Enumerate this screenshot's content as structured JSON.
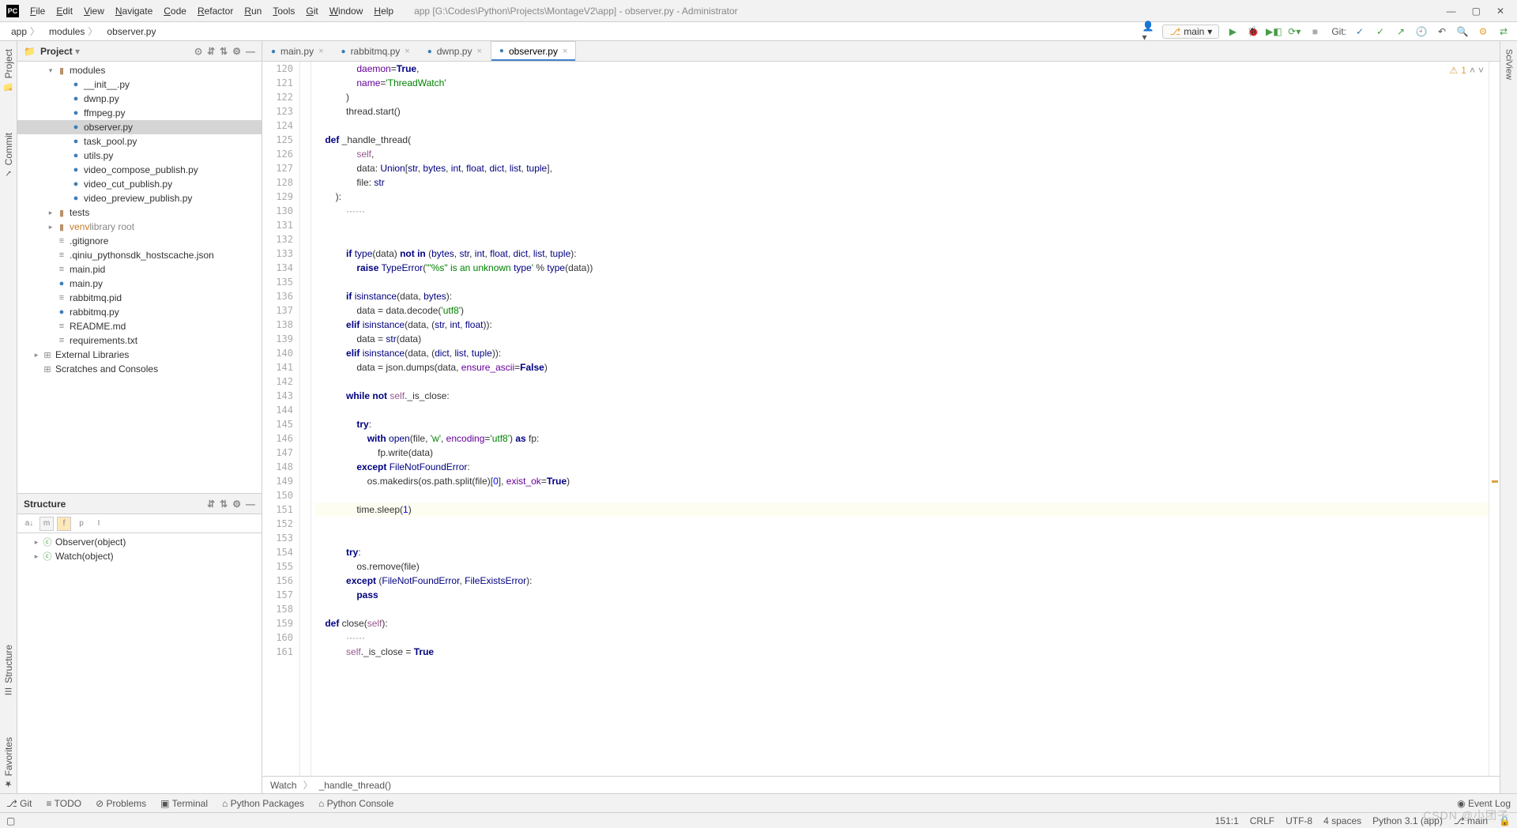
{
  "window": {
    "title": "app [G:\\Codes\\Python\\Projects\\MontageV2\\app] - observer.py - Administrator"
  },
  "menus": [
    "File",
    "Edit",
    "View",
    "Navigate",
    "Code",
    "Refactor",
    "Run",
    "Tools",
    "Git",
    "Window",
    "Help"
  ],
  "breadcrumbs": [
    "app",
    "modules",
    "observer.py"
  ],
  "branch": "main",
  "git_label": "Git:",
  "left_tabs": {
    "project": "Project",
    "commit": "Commit",
    "structure": "Structure",
    "favorites": "Favorites"
  },
  "right_tab": "SciView",
  "project_panel": {
    "title": "Project",
    "tree": [
      {
        "indent": 1,
        "arrow": "▾",
        "icon": "dir",
        "label": "modules"
      },
      {
        "indent": 2,
        "arrow": "",
        "icon": "py",
        "label": "__init__.py"
      },
      {
        "indent": 2,
        "arrow": "",
        "icon": "py",
        "label": "dwnp.py"
      },
      {
        "indent": 2,
        "arrow": "",
        "icon": "py",
        "label": "ffmpeg.py"
      },
      {
        "indent": 2,
        "arrow": "",
        "icon": "py",
        "label": "observer.py",
        "selected": true
      },
      {
        "indent": 2,
        "arrow": "",
        "icon": "py",
        "label": "task_pool.py"
      },
      {
        "indent": 2,
        "arrow": "",
        "icon": "py",
        "label": "utils.py"
      },
      {
        "indent": 2,
        "arrow": "",
        "icon": "py",
        "label": "video_compose_publish.py"
      },
      {
        "indent": 2,
        "arrow": "",
        "icon": "py",
        "label": "video_cut_publish.py"
      },
      {
        "indent": 2,
        "arrow": "",
        "icon": "py",
        "label": "video_preview_publish.py"
      },
      {
        "indent": 1,
        "arrow": "▸",
        "icon": "dir",
        "label": "tests"
      },
      {
        "indent": 1,
        "arrow": "▸",
        "icon": "dir",
        "label": "venv",
        "libroot": true,
        "extra": "library root"
      },
      {
        "indent": 1,
        "arrow": "",
        "icon": "txt",
        "label": ".gitignore"
      },
      {
        "indent": 1,
        "arrow": "",
        "icon": "txt",
        "label": ".qiniu_pythonsdk_hostscache.json"
      },
      {
        "indent": 1,
        "arrow": "",
        "icon": "txt",
        "label": "main.pid"
      },
      {
        "indent": 1,
        "arrow": "",
        "icon": "py",
        "label": "main.py"
      },
      {
        "indent": 1,
        "arrow": "",
        "icon": "txt",
        "label": "rabbitmq.pid"
      },
      {
        "indent": 1,
        "arrow": "",
        "icon": "py",
        "label": "rabbitmq.py"
      },
      {
        "indent": 1,
        "arrow": "",
        "icon": "txt",
        "label": "README.md"
      },
      {
        "indent": 1,
        "arrow": "",
        "icon": "txt",
        "label": "requirements.txt"
      },
      {
        "indent": 0,
        "arrow": "▸",
        "icon": "lib",
        "label": "External Libraries"
      },
      {
        "indent": 0,
        "arrow": "",
        "icon": "lib",
        "label": "Scratches and Consoles"
      }
    ]
  },
  "structure_panel": {
    "title": "Structure",
    "items": [
      "Observer(object)",
      "Watch(object)"
    ]
  },
  "tabs": [
    {
      "label": "main.py",
      "active": false
    },
    {
      "label": "rabbitmq.py",
      "active": false
    },
    {
      "label": "dwnp.py",
      "active": false
    },
    {
      "label": "observer.py",
      "active": true
    }
  ],
  "line_start": 120,
  "line_end": 160,
  "warning_count": "1",
  "code_lines": [
    "                daemon=True,",
    "                name='ThreadWatch'",
    "            )",
    "            thread.start()",
    "",
    "    def _handle_thread(",
    "                self,",
    "                data: Union[str, bytes, int, float, dict, list, tuple],",
    "                file: str",
    "        ):",
    "            ······",
    "",
    "",
    "            if type(data) not in (bytes, str, int, float, dict, list, tuple):",
    "                raise TypeError('\"%s\" is an unknown type' % type(data))",
    "",
    "            if isinstance(data, bytes):",
    "                data = data.decode('utf8')",
    "            elif isinstance(data, (str, int, float)):",
    "                data = str(data)",
    "            elif isinstance(data, (dict, list, tuple)):",
    "                data = json.dumps(data, ensure_ascii=False)",
    "",
    "            while not self._is_close:",
    "",
    "                try:",
    "                    with open(file, 'w', encoding='utf8') as fp:",
    "                        fp.write(data)",
    "                except FileNotFoundError:",
    "                    os.makedirs(os.path.split(file)[0], exist_ok=True)",
    "",
    "                time.sleep(1)",
    "",
    "            try:",
    "                os.remove(file)",
    "            except (FileNotFoundError, FileExistsError):",
    "                pass",
    "",
    "    def close(self):",
    "            ······",
    "            self._is_close = True",
    ""
  ],
  "crumb_nav": [
    "Watch",
    "_handle_thread()"
  ],
  "bottom_tools": [
    "Git",
    "TODO",
    "Problems",
    "Terminal",
    "Python Packages",
    "Python Console"
  ],
  "event_log": "Event Log",
  "status": {
    "pos": "151:1",
    "eol": "CRLF",
    "enc": "UTF-8",
    "indent": "4 spaces",
    "python": "Python 3.1 (app)",
    "branch": "main"
  },
  "watermark": "CSDN @小团子"
}
